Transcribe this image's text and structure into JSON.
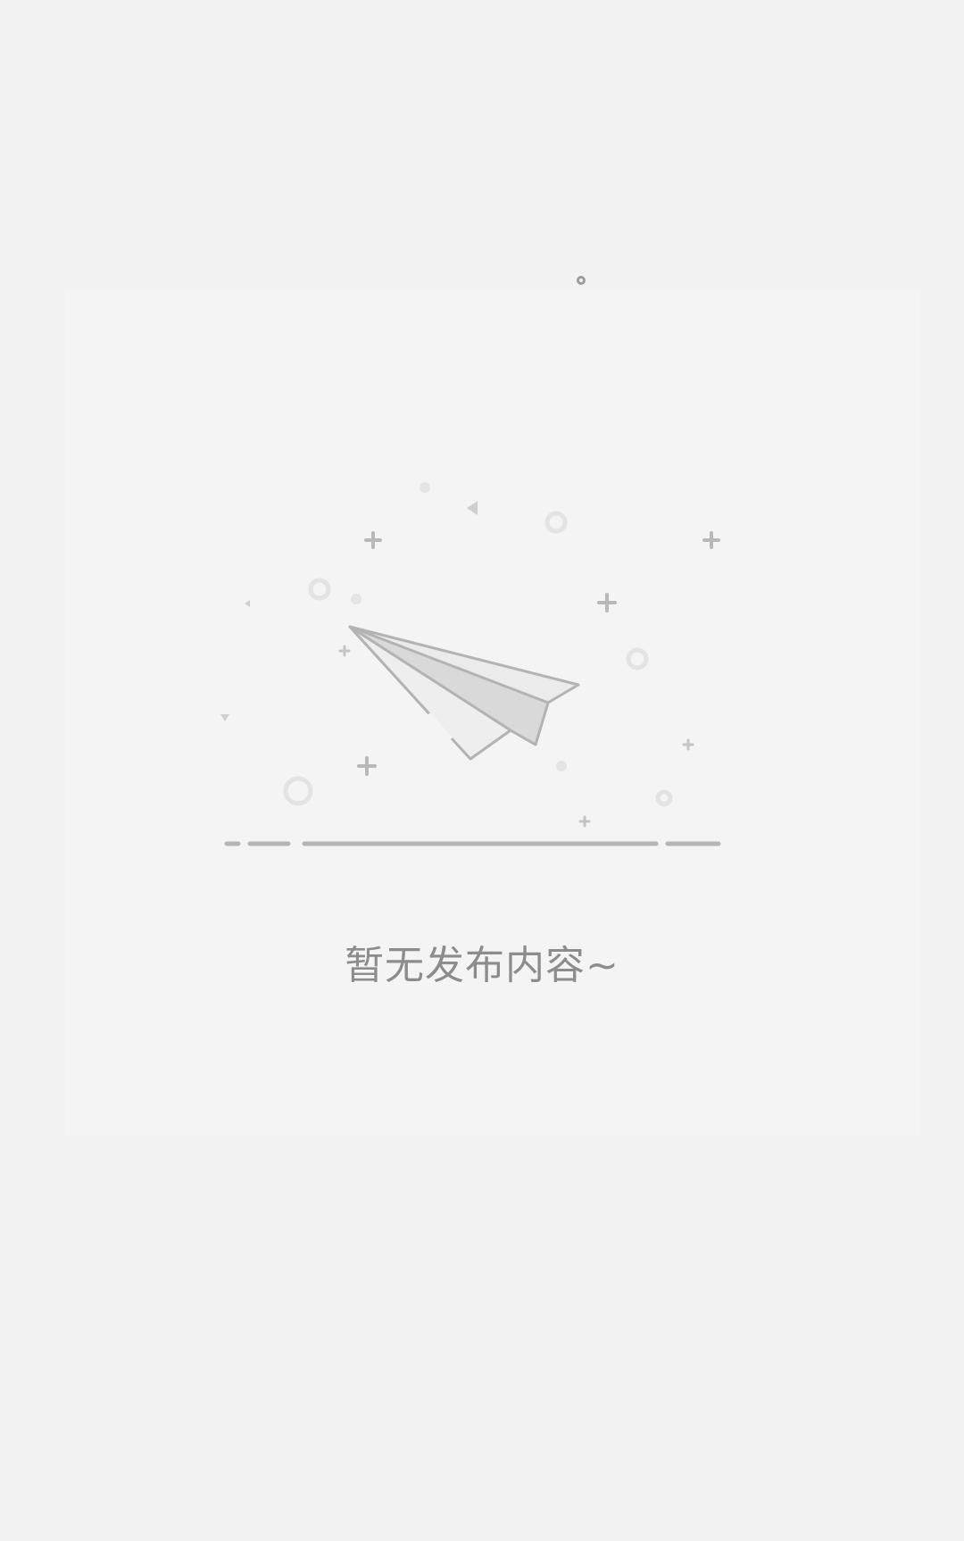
{
  "empty_state": {
    "message": "暂无发布内容~",
    "icon": "paper-plane-icon"
  },
  "colors": {
    "background": "#f2f2f2",
    "card": "#f4f4f4",
    "text": "#8c8c8c",
    "illustration_stroke": "#b5b5b5",
    "illustration_fill": "#e9e9e9"
  }
}
